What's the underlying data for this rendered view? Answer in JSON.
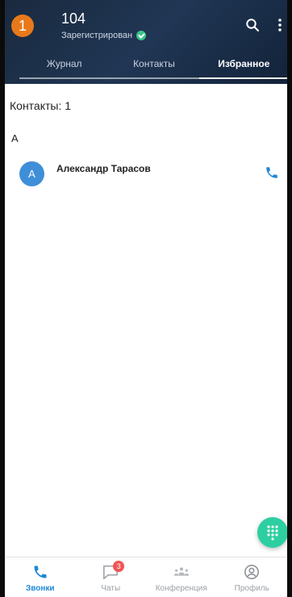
{
  "header": {
    "avatar_letter": "1",
    "extension": "104",
    "status": "Зарегистрирован",
    "tabs": [
      {
        "label": "Журнал"
      },
      {
        "label": "Контакты"
      },
      {
        "label": "Избранное"
      }
    ],
    "active_tab": "Избранное"
  },
  "main": {
    "count_label": "Контакты: 1",
    "section_letter": "А",
    "contacts": [
      {
        "initial": "А",
        "name": "Александр Тарасов"
      }
    ]
  },
  "bottom_nav": {
    "items": [
      {
        "label": "Звонки",
        "icon": "phone-icon",
        "active": true
      },
      {
        "label": "Чаты",
        "icon": "chat-icon",
        "badge": "3"
      },
      {
        "label": "Конференция",
        "icon": "conference-icon"
      },
      {
        "label": "Профиль",
        "icon": "profile-icon"
      }
    ]
  },
  "colors": {
    "header_bg": "#1a2a3f",
    "avatar_orange": "#e8791b",
    "accent_blue": "#1e88d6",
    "fab_green": "#2dcfa0",
    "badge_red": "#f05454",
    "status_green": "#3cc48b"
  }
}
